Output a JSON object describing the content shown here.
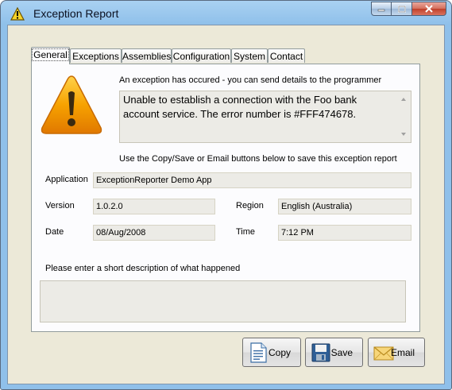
{
  "window": {
    "title": "Exception Report",
    "icon": "warning-icon",
    "caption_buttons": [
      "minimize-icon",
      "maximize-icon",
      "close-icon"
    ]
  },
  "tabs": [
    {
      "label": "General",
      "active": true
    },
    {
      "label": "Exceptions",
      "active": false
    },
    {
      "label": "Assemblies",
      "active": false
    },
    {
      "label": "Configuration",
      "active": false
    },
    {
      "label": "System",
      "active": false
    },
    {
      "label": "Contact",
      "active": false
    }
  ],
  "general": {
    "intro": "An exception has occured - you can send details to the programmer",
    "message": "Unable to establish a connection with the Foo bank account service. The error number is #FFF474678.",
    "instructions": "Use the Copy/Save or Email buttons below to save this exception report",
    "application_label": "Application",
    "application_value": "ExceptionReporter Demo App",
    "version_label": "Version",
    "version_value": "1.0.2.0",
    "region_label": "Region",
    "region_value": "English (Australia)",
    "date_label": "Date",
    "date_value": "08/Aug/2008",
    "time_label": "Time",
    "time_value": "7:12 PM",
    "description_prompt": "Please enter a short description of what happened",
    "description_value": ""
  },
  "buttons": {
    "copy": {
      "label": "Copy",
      "icon": "document-icon"
    },
    "save": {
      "label": "Save",
      "icon": "floppy-disk-icon"
    },
    "email": {
      "label": "Email",
      "icon": "envelope-icon"
    }
  },
  "colors": {
    "warning_orange": "#f7a200",
    "title_bar": "#8fc0ea"
  }
}
